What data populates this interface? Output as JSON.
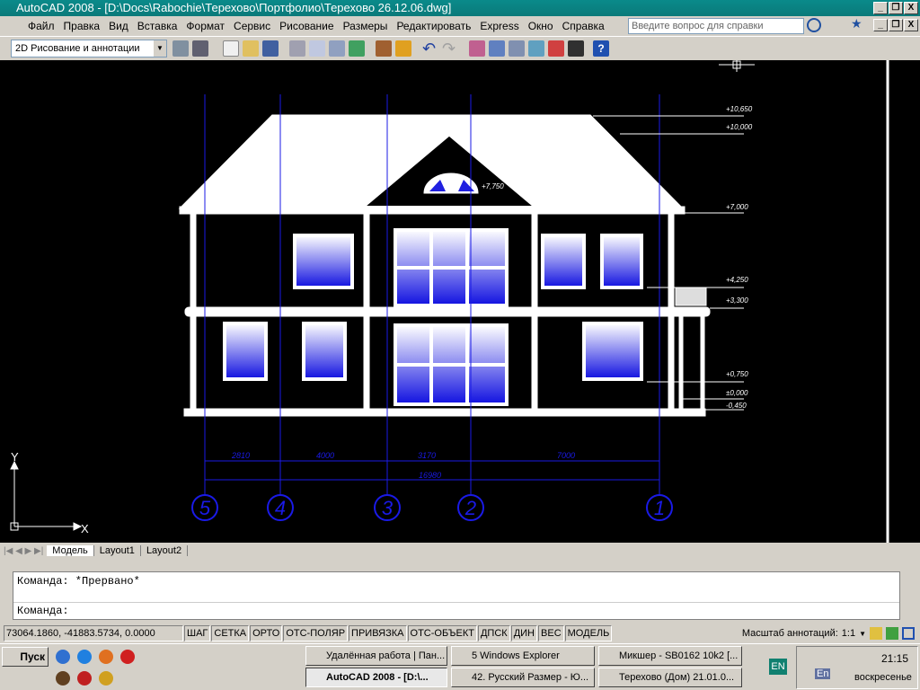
{
  "window": {
    "title": "AutoCAD 2008 - [D:\\Docs\\Rabochie\\Терехово\\Портфолио\\Терехово 26.12.06.dwg]"
  },
  "menu": [
    "Файл",
    "Правка",
    "Вид",
    "Вставка",
    "Формат",
    "Сервис",
    "Рисование",
    "Размеры",
    "Редактировать",
    "Express",
    "Окно",
    "Справка"
  ],
  "help": {
    "placeholder": "Введите вопрос для справки"
  },
  "toolbar": {
    "workspace": "2D Рисование и аннотации"
  },
  "drawing": {
    "elevations": [
      "+10,650",
      "+10,000",
      "+7,000",
      "+4,250",
      "+3,300",
      "+0,750",
      "±0,000",
      "-0,450"
    ],
    "window_label": "+7,750",
    "dimensions": [
      "2810",
      "4000",
      "3170",
      "7000"
    ],
    "total_dimension": "16980",
    "axes": [
      "5",
      "4",
      "3",
      "2",
      "1"
    ],
    "ucs": {
      "x": "X",
      "y": "Y"
    },
    "colors": {
      "background": "#000000",
      "grid": "#1a1ae6",
      "building": "#ffffff"
    }
  },
  "tabs": [
    {
      "label": "Модель",
      "active": true
    },
    {
      "label": "Layout1"
    },
    {
      "label": "Layout2"
    }
  ],
  "command": {
    "history": "Команда:  *Прервано*",
    "prompt": "Команда:"
  },
  "status": {
    "coords": "73064.1860, -41883.5734, 0.0000",
    "toggles": [
      "ШАГ",
      "СЕТКА",
      "ОРТО",
      "ОТС-ПОЛЯР",
      "ПРИВЯЗКА",
      "ОТС-ОБЪЕКТ",
      "ДПСК",
      "ДИН",
      "ВЕС",
      "МОДЕЛЬ"
    ],
    "annot_label": "Масштаб аннотаций:",
    "annot_value": "1:1"
  },
  "taskbar": {
    "start": "Пуск",
    "tasks_top": [
      "Удалённая работа | Пан...",
      "5 Windows Explorer",
      "Микшер - SB0162 10k2 [..."
    ],
    "tasks_bottom": [
      "AutoCAD 2008 - [D:\\...",
      "42. Русский Размер - Ю...",
      "Терехово (Дом) 21.01.0..."
    ],
    "lang": "EN",
    "tray_lang": "En",
    "time": "21:15",
    "day": "воскресенье"
  }
}
